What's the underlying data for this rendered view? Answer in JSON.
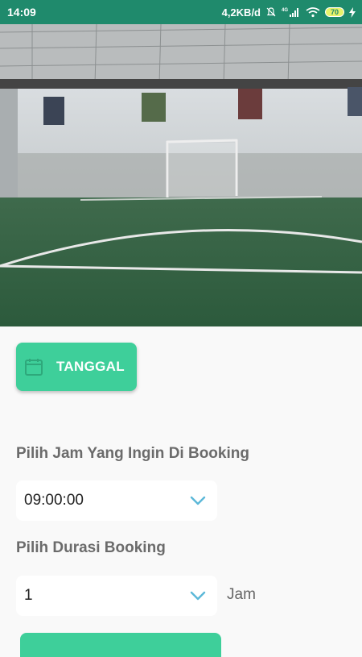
{
  "status_bar": {
    "time": "14:09",
    "network_speed": "4,2KB/d",
    "network_type": "4G",
    "battery_level": "70",
    "icons": [
      "mute-bell-icon",
      "signal-icon",
      "wifi-icon",
      "battery-icon",
      "charging-icon"
    ]
  },
  "hero": {
    "image": "futsal-court-photo"
  },
  "date_button": {
    "label": "TANGGAL",
    "icon": "calendar-icon"
  },
  "time_select": {
    "label": "Pilih Jam Yang Ingin Di Booking",
    "value": "09:00:00"
  },
  "duration_select": {
    "label": "Pilih Durasi Booking",
    "value": "1",
    "unit": "Jam"
  },
  "colors": {
    "status_bar": "#1f8a6c",
    "accent": "#3ecf9a",
    "chevron": "#5bb8d8"
  }
}
